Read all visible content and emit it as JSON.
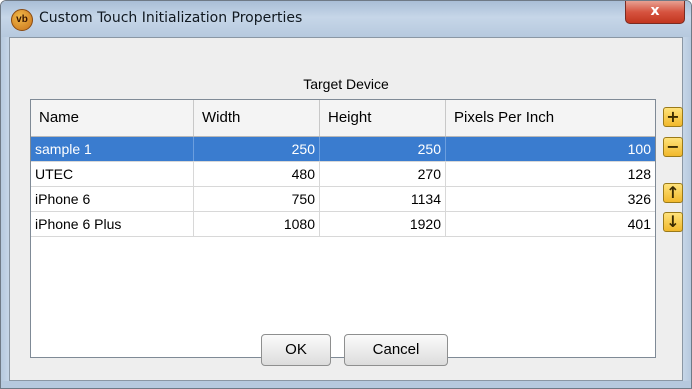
{
  "window": {
    "title": "Custom Touch Initialization Properties",
    "app_icon": "vb",
    "close_glyph": "x"
  },
  "section": {
    "title": "Target Device"
  },
  "table": {
    "columns": [
      "Name",
      "Width",
      "Height",
      "Pixels Per Inch"
    ],
    "rows": [
      {
        "name": "sample 1",
        "width": "250",
        "height": "250",
        "ppi": "100",
        "selected": true
      },
      {
        "name": "UTEC",
        "width": "480",
        "height": "270",
        "ppi": "128",
        "selected": false
      },
      {
        "name": "iPhone 6",
        "width": "750",
        "height": "1134",
        "ppi": "326",
        "selected": false
      },
      {
        "name": "iPhone 6 Plus",
        "width": "1080",
        "height": "1920",
        "ppi": "401",
        "selected": false
      }
    ]
  },
  "side_buttons": {
    "add": {
      "icon": "plus-icon",
      "glyph": "+"
    },
    "remove": {
      "icon": "minus-icon",
      "glyph": "−"
    },
    "up": {
      "icon": "arrow-up-icon",
      "glyph": "↑"
    },
    "down": {
      "icon": "arrow-down-icon",
      "glyph": "↓"
    }
  },
  "buttons": {
    "ok": "OK",
    "cancel": "Cancel"
  },
  "colors": {
    "selection": "#3a7ccf",
    "close_button": "#c2361f",
    "side_button": "#f1b82c"
  }
}
